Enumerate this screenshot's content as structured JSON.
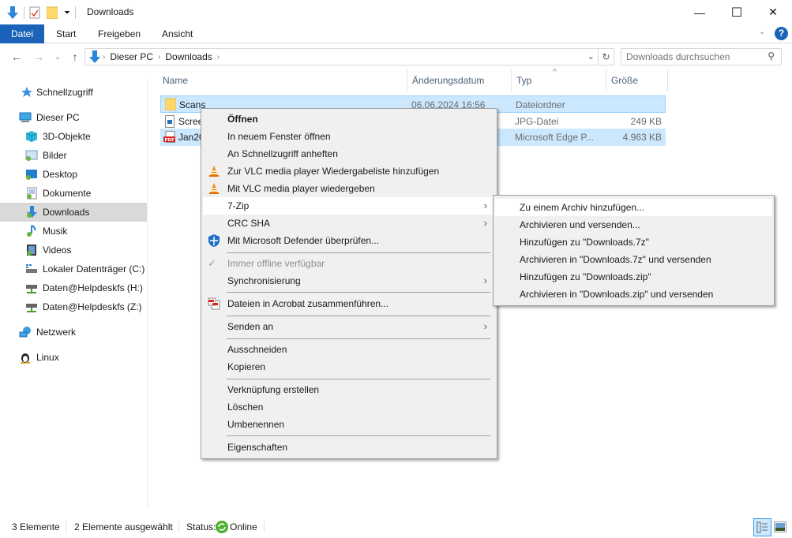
{
  "window": {
    "title": "Downloads",
    "controls": {
      "minimize": "—",
      "maximize": "☐",
      "close": "✕"
    }
  },
  "ribbon": {
    "tabs": [
      {
        "label": "Datei",
        "active": true
      },
      {
        "label": "Start"
      },
      {
        "label": "Freigeben"
      },
      {
        "label": "Ansicht"
      }
    ],
    "help_label": "?"
  },
  "address": {
    "breadcrumb": [
      "Dieser PC",
      "Downloads"
    ],
    "search_placeholder": "Downloads durchsuchen"
  },
  "sidebar": {
    "items": [
      {
        "label": "Schnellzugriff",
        "icon": "star-icon",
        "level": 0
      },
      {
        "label": "Dieser PC",
        "icon": "computer-icon",
        "level": 0
      },
      {
        "label": "3D-Objekte",
        "icon": "cube-icon",
        "level": 1
      },
      {
        "label": "Bilder",
        "icon": "pictures-icon",
        "level": 1
      },
      {
        "label": "Desktop",
        "icon": "desktop-icon",
        "level": 1
      },
      {
        "label": "Dokumente",
        "icon": "documents-icon",
        "level": 1
      },
      {
        "label": "Downloads",
        "icon": "downloads-icon",
        "level": 1,
        "selected": true
      },
      {
        "label": "Musik",
        "icon": "music-icon",
        "level": 1
      },
      {
        "label": "Videos",
        "icon": "videos-icon",
        "level": 1
      },
      {
        "label": "Lokaler Datenträger (C:)",
        "icon": "drive-icon",
        "level": 1
      },
      {
        "label": "Daten@Helpdeskfs (H:)",
        "icon": "network-drive-icon",
        "level": 1
      },
      {
        "label": "Daten@Helpdeskfs (Z:)",
        "icon": "network-drive-icon",
        "level": 1
      },
      {
        "label": "Netzwerk",
        "icon": "network-icon",
        "level": 0
      },
      {
        "label": "Linux",
        "icon": "linux-icon",
        "level": 0
      }
    ]
  },
  "files": {
    "columns": [
      "Name",
      "Änderungsdatum",
      "Typ",
      "Größe"
    ],
    "sort_indicator": "^",
    "rows": [
      {
        "name": "Scans",
        "date": "06.06.2024 16:56",
        "type": "Dateiordner",
        "size": "",
        "icon": "folder-icon",
        "selected": true
      },
      {
        "name": "Scree",
        "date": "",
        "type": "JPG-Datei",
        "size": "249 KB",
        "icon": "image-file-icon",
        "selected": false
      },
      {
        "name": "Jan20",
        "date": "",
        "type": "Microsoft Edge P...",
        "size": "4.963 KB",
        "icon": "pdf-icon",
        "selected": true
      }
    ]
  },
  "context_menu": {
    "items": [
      {
        "label": "Öffnen",
        "bold": true
      },
      {
        "label": "In neuem Fenster öffnen"
      },
      {
        "label": "An Schnellzugriff anheften"
      },
      {
        "label": "Zur VLC media player Wiedergabeliste hinzufügen",
        "icon": "vlc-icon"
      },
      {
        "label": "Mit VLC media player wiedergeben",
        "icon": "vlc-icon"
      },
      {
        "label": "7-Zip",
        "submenu": true,
        "highlighted": true
      },
      {
        "label": "CRC SHA",
        "submenu": true
      },
      {
        "label": "Mit Microsoft Defender überprüfen...",
        "icon": "defender-icon"
      },
      {
        "separator": true
      },
      {
        "label": "Immer offline verfügbar",
        "disabled": true,
        "checked": true
      },
      {
        "label": "Synchronisierung",
        "submenu": true
      },
      {
        "separator": true
      },
      {
        "label": "Dateien in Acrobat zusammenführen...",
        "icon": "acrobat-icon"
      },
      {
        "separator": true
      },
      {
        "label": "Senden an",
        "submenu": true
      },
      {
        "separator": true
      },
      {
        "label": "Ausschneiden"
      },
      {
        "label": "Kopieren"
      },
      {
        "separator": true
      },
      {
        "label": "Verknüpfung erstellen"
      },
      {
        "label": "Löschen"
      },
      {
        "label": "Umbenennen"
      },
      {
        "separator": true
      },
      {
        "label": "Eigenschaften"
      }
    ]
  },
  "submenu_7zip": {
    "items": [
      {
        "label": "Zu einem Archiv hinzufügen...",
        "highlighted": true
      },
      {
        "label": "Archivieren und versenden..."
      },
      {
        "label": "Hinzufügen zu \"Downloads.7z\""
      },
      {
        "label": "Archivieren in \"Downloads.7z\" und versenden"
      },
      {
        "label": "Hinzufügen zu \"Downloads.zip\""
      },
      {
        "label": "Archivieren in \"Downloads.zip\" und versenden"
      }
    ]
  },
  "statusbar": {
    "count": "3 Elemente",
    "selected": "2 Elemente ausgewählt",
    "status_label": "Status:",
    "status_value": "Online"
  },
  "colors": {
    "accent": "#1a63b8",
    "selection": "#cce8ff",
    "selection_border": "#99d1ff",
    "menu_bg": "#f0f0f0",
    "header_text": "#4c607a"
  }
}
